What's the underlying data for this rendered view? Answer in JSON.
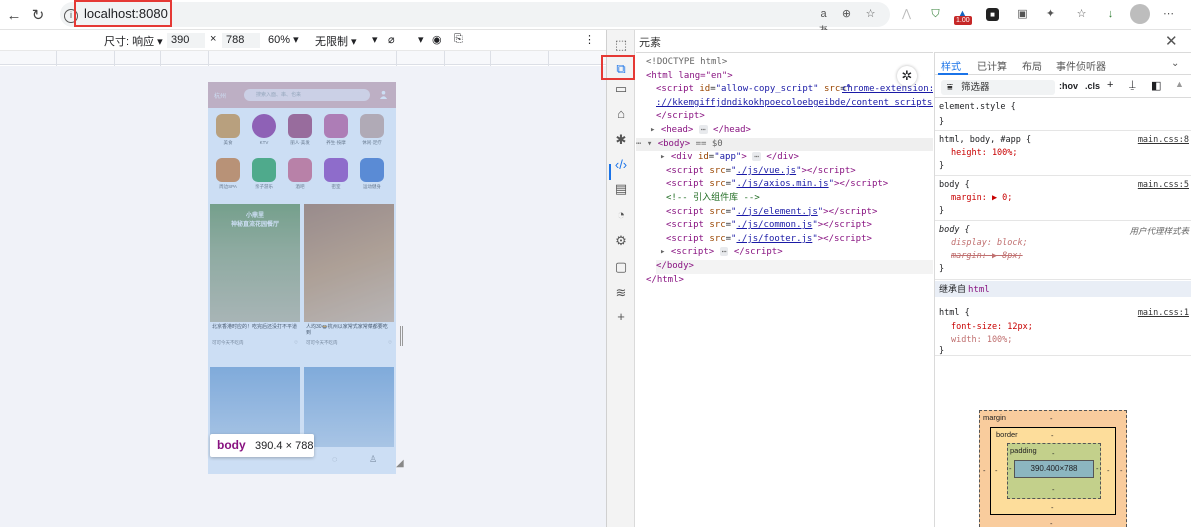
{
  "browser": {
    "url": "localhost:8080",
    "info_icon": "i",
    "zoom_indicator": "aあ",
    "badge": "1.00"
  },
  "devicebar": {
    "size_label": "尺寸: 响应",
    "width": "390",
    "times": "×",
    "height": "788",
    "zoom": "60%",
    "throttle": "无限制"
  },
  "phone": {
    "city": "杭州",
    "search_placeholder": "搜索入面、串、也来",
    "categories": [
      "美食",
      "KTV",
      "丽人·美发",
      "养生·按摩",
      "休闲·足疗",
      "周边SPA",
      "亲子游乐",
      "酒吧",
      "密室",
      "运动健身"
    ],
    "cards": [
      {
        "overlay": "小鼎里\n神秘直流花园餐厅",
        "title": "北京香港时应的！吃完后还没打不平道",
        "author": "可可今天不吃肉"
      },
      {
        "overlay": "",
        "title": "人均30🍲杭州以家常式家常菜都要吃到",
        "author": "可可今天不吃肉"
      }
    ],
    "tooltip_tag": "body",
    "tooltip_size": "390.4 × 788"
  },
  "devtools": {
    "title": "元素",
    "code": {
      "doctype": "<!DOCTYPE html>",
      "html_open": "<html lang=\"en\">",
      "script1_src": "chrome-extension://kkemgiffjdndikokhpoecoloebgeibde/content_scripts/copy.js",
      "script1_id": "allow-copy_script",
      "head": "<head>",
      "body_marker": "== $0",
      "div_app": "app",
      "comment": "<!-- 引入组件库 -->",
      "scripts": [
        "./js/vue.js",
        "./js/axios.min.js",
        "./js/element.js",
        "./js/common.js",
        "./js/footer.js"
      ]
    },
    "styles": {
      "tabs": [
        "样式",
        "已计算",
        "布局",
        "事件侦听器"
      ],
      "filter": "筛选器",
      "hov": ":hov",
      "cls": ".cls",
      "rules": [
        {
          "sel": "element.style {",
          "src": ""
        },
        {
          "sel": "html, body, #app {",
          "src": "main.css:8",
          "decl": "height: 100%;"
        },
        {
          "sel": "body {",
          "src": "main.css:5",
          "decl": "margin: ▶ 0;"
        },
        {
          "sel": "body {",
          "src": "用户代理样式表",
          "decl1": "display: block;",
          "decl2": "margin: ▶ 8px;"
        },
        {
          "sel": "html {",
          "src": "main.css:1",
          "decl1": "font-size: 12px;",
          "decl2": "width: 100%;"
        }
      ],
      "inherited_label": "继承自",
      "inherited_tag": "html",
      "boxmodel": {
        "margin": "margin",
        "border": "border",
        "padding": "padding",
        "content": "390.400×788",
        "dash": "-"
      }
    }
  }
}
